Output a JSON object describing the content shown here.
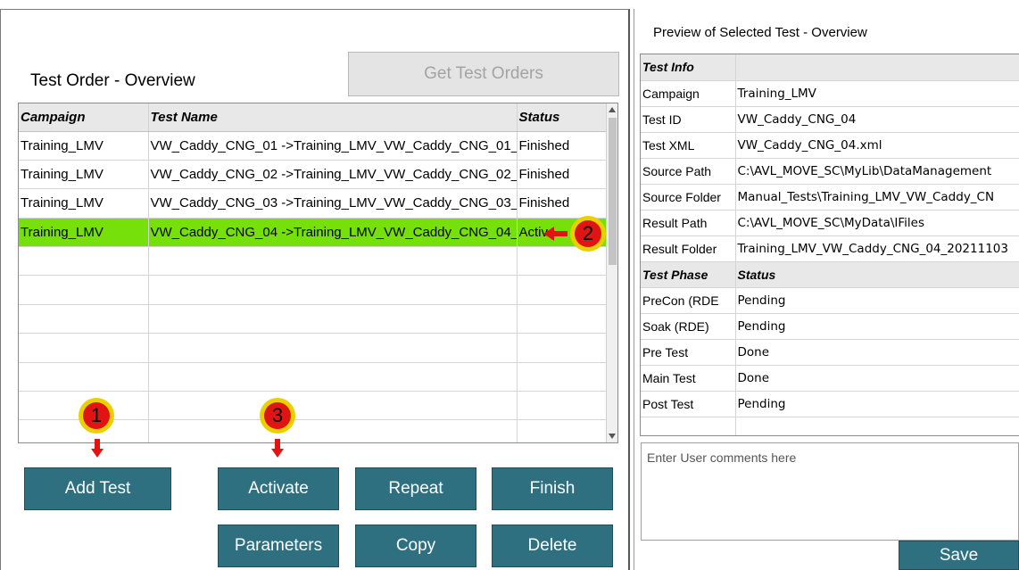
{
  "left": {
    "title": "Test Order - Overview",
    "get_orders_label": "Get Test Orders",
    "columns": [
      "Campaign",
      "Test Name",
      "Status"
    ],
    "rows": [
      {
        "campaign": "Training_LMV",
        "test_name": "VW_Caddy_CNG_01 ->Training_LMV_VW_Caddy_CNG_01_",
        "status": "Finished"
      },
      {
        "campaign": "Training_LMV",
        "test_name": "VW_Caddy_CNG_02 ->Training_LMV_VW_Caddy_CNG_02_",
        "status": "Finished"
      },
      {
        "campaign": "Training_LMV",
        "test_name": "VW_Caddy_CNG_03 ->Training_LMV_VW_Caddy_CNG_03_",
        "status": "Finished"
      },
      {
        "campaign": "Training_LMV",
        "test_name": "VW_Caddy_CNG_04 ->Training_LMV_VW_Caddy_CNG_04_",
        "status": "Active"
      }
    ],
    "buttons": {
      "add_test": "Add Test",
      "activate": "Activate",
      "repeat": "Repeat",
      "finish": "Finish",
      "parameters": "Parameters",
      "copy": "Copy",
      "delete": "Delete"
    },
    "markers": {
      "m1": "1",
      "m2": "2",
      "m3": "3"
    }
  },
  "right": {
    "title": "Preview of Selected Test - Overview",
    "info_header": "Test Info",
    "info": [
      {
        "key": "Campaign",
        "value": "Training_LMV"
      },
      {
        "key": "Test ID",
        "value": "VW_Caddy_CNG_04"
      },
      {
        "key": "Test XML",
        "value": "VW_Caddy_CNG_04.xml"
      },
      {
        "key": "Source Path",
        "value": "C:\\AVL_MOVE_SC\\MyLib\\DataManagement"
      },
      {
        "key": "Source Folder",
        "value": "Manual_Tests\\Training_LMV_VW_Caddy_CN"
      },
      {
        "key": "Result  Path",
        "value": "C:\\AVL_MOVE_SC\\MyData\\IFiles"
      },
      {
        "key": "Result  Folder",
        "value": "Training_LMV_VW_Caddy_CNG_04_20211103"
      }
    ],
    "phase_header": {
      "phase": "Test Phase",
      "status": "Status"
    },
    "phases": [
      {
        "phase": "PreCon (RDE",
        "status": "Pending"
      },
      {
        "phase": "Soak (RDE)",
        "status": "Pending"
      },
      {
        "phase": "Pre Test",
        "status": "Done"
      },
      {
        "phase": "Main Test",
        "status": "Done"
      },
      {
        "phase": "Post Test",
        "status": "Pending"
      }
    ],
    "comments_placeholder": "Enter User comments here",
    "save_label": "Save"
  },
  "colors": {
    "button": "#2e7080",
    "active_row": "#76e00a",
    "marker_fill": "#e11414",
    "marker_ring": "#e8d100"
  }
}
